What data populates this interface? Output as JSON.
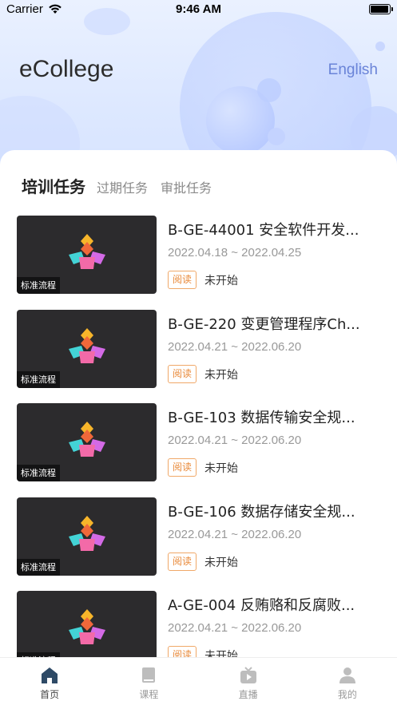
{
  "status_bar": {
    "carrier": "Carrier",
    "time": "9:46 AM"
  },
  "header": {
    "app_title": "eCollege",
    "language_button": "English"
  },
  "tabs": [
    {
      "label": "培训任务",
      "active": true
    },
    {
      "label": "过期任务",
      "active": false
    },
    {
      "label": "审批任务",
      "active": false
    }
  ],
  "tasks": [
    {
      "thumb_tag": "标准流程",
      "title": "B-GE-44001 安全软件开发...",
      "date_range": "2022.04.18 ~ 2022.04.25",
      "badge": "阅读",
      "status": "未开始"
    },
    {
      "thumb_tag": "标准流程",
      "title": "B-GE-220 变更管理程序Ch...",
      "date_range": "2022.04.21 ~ 2022.06.20",
      "badge": "阅读",
      "status": "未开始"
    },
    {
      "thumb_tag": "标准流程",
      "title": "B-GE-103 数据传输安全规...",
      "date_range": "2022.04.21 ~ 2022.06.20",
      "badge": "阅读",
      "status": "未开始"
    },
    {
      "thumb_tag": "标准流程",
      "title": "B-GE-106 数据存储安全规...",
      "date_range": "2022.04.21 ~ 2022.06.20",
      "badge": "阅读",
      "status": "未开始"
    },
    {
      "thumb_tag": "标准流程",
      "title": "A-GE-004 反贿赂和反腐败...",
      "date_range": "2022.04.21 ~ 2022.06.20",
      "badge": "阅读",
      "status": "未开始"
    }
  ],
  "tab_bar": [
    {
      "label": "首页",
      "icon": "home-icon",
      "active": true
    },
    {
      "label": "课程",
      "icon": "book-icon",
      "active": false
    },
    {
      "label": "直播",
      "icon": "live-tv-icon",
      "active": false
    },
    {
      "label": "我的",
      "icon": "person-icon",
      "active": false
    }
  ],
  "colors": {
    "accent": "#6a84d8",
    "badge": "#e98a3a",
    "thumb_bg": "#2c2b2d"
  }
}
